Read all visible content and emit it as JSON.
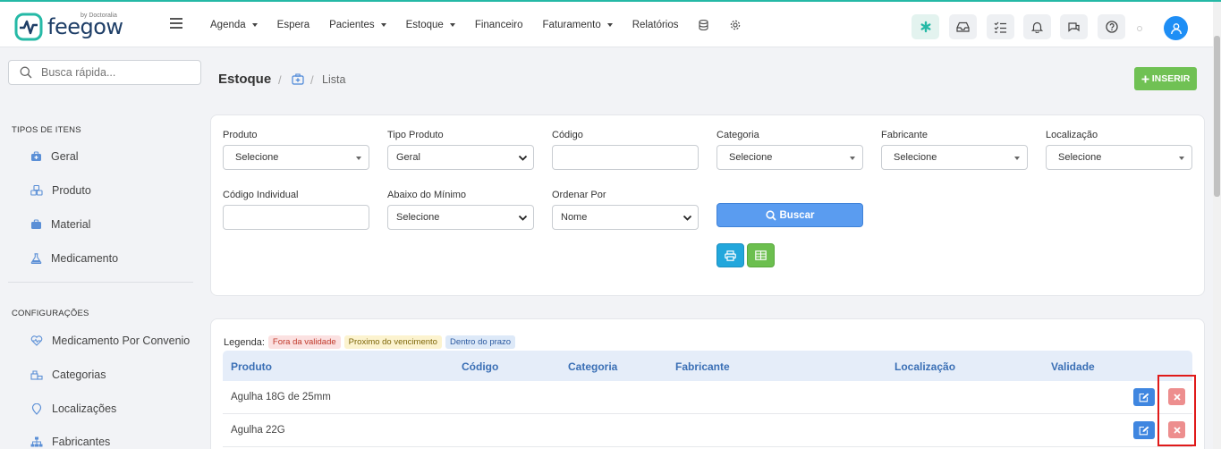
{
  "brand": {
    "name": "feegow",
    "tagline": "by Doctoralia"
  },
  "nav": {
    "items": [
      {
        "label": "Agenda",
        "dropdown": true
      },
      {
        "label": "Espera",
        "dropdown": false
      },
      {
        "label": "Pacientes",
        "dropdown": true
      },
      {
        "label": "Estoque",
        "dropdown": true
      },
      {
        "label": "Financeiro",
        "dropdown": false
      },
      {
        "label": "Faturamento",
        "dropdown": true
      },
      {
        "label": "Relatórios",
        "dropdown": false
      }
    ],
    "icons": [
      "database-icon",
      "gear-icon"
    ]
  },
  "toolbar_icons": [
    "asterisk-icon",
    "inbox-icon",
    "checklist-icon",
    "bell-icon",
    "chat-icon",
    "help-icon",
    "user-avatar-icon"
  ],
  "sidebar": {
    "search_placeholder": "Busca rápida...",
    "section1_title": "TIPOS DE ITENS",
    "section1_items": [
      {
        "label": "Geral",
        "icon": "briefcase-medical-icon"
      },
      {
        "label": "Produto",
        "icon": "cubes-icon"
      },
      {
        "label": "Material",
        "icon": "briefcase-icon"
      },
      {
        "label": "Medicamento",
        "icon": "flask-icon"
      }
    ],
    "section2_title": "CONFIGURAÇÕES",
    "section2_items": [
      {
        "label": "Medicamento Por Convenio",
        "icon": "heartbeat-icon"
      },
      {
        "label": "Categorias",
        "icon": "sitemap-icon"
      },
      {
        "label": "Localizações",
        "icon": "map-marker-icon"
      },
      {
        "label": "Fabricantes",
        "icon": "hierarchy-icon"
      }
    ]
  },
  "header": {
    "title": "Estoque",
    "crumb_icon": "medical-kit-icon",
    "crumb": "Lista",
    "insert_label": "INSERIR"
  },
  "filters": {
    "produto": {
      "label": "Produto",
      "value": "Selecione"
    },
    "tipo_produto": {
      "label": "Tipo Produto",
      "value": "Geral"
    },
    "codigo": {
      "label": "Código",
      "value": ""
    },
    "categoria": {
      "label": "Categoria",
      "value": "Selecione"
    },
    "fabricante": {
      "label": "Fabricante",
      "value": "Selecione"
    },
    "localizacao": {
      "label": "Localização",
      "value": "Selecione"
    },
    "codigo_individual": {
      "label": "Código Individual",
      "value": ""
    },
    "abaixo_minimo": {
      "label": "Abaixo do Mínimo",
      "value": "Selecione"
    },
    "ordenar_por": {
      "label": "Ordenar Por",
      "value": "Nome"
    },
    "buscar_label": "Buscar"
  },
  "legend": {
    "label": "Legenda:",
    "items": [
      {
        "text": "Fora da validade",
        "bg": "#fbe1e1",
        "color": "#c0392b"
      },
      {
        "text": "Proximo do vencimento",
        "bg": "#fcf3cf",
        "color": "#7d6608"
      },
      {
        "text": "Dentro do prazo",
        "bg": "#dde9f8",
        "color": "#2c5aa0"
      }
    ]
  },
  "table": {
    "columns": [
      "Produto",
      "Código",
      "Categoria",
      "Fabricante",
      "Localização",
      "Validade"
    ],
    "rows": [
      {
        "produto": "Agulha 18G de 25mm",
        "codigo": "",
        "categoria": "",
        "fabricante": "",
        "localizacao": "",
        "validade": ""
      },
      {
        "produto": "Agulha 22G",
        "codigo": "",
        "categoria": "",
        "fabricante": "",
        "localizacao": "",
        "validade": ""
      }
    ]
  },
  "colors": {
    "accent": "#25b9a6",
    "primary": "#5a9cf0",
    "success": "#70c154",
    "danger": "#ed8e8e",
    "highlight": "#e01a1a"
  }
}
